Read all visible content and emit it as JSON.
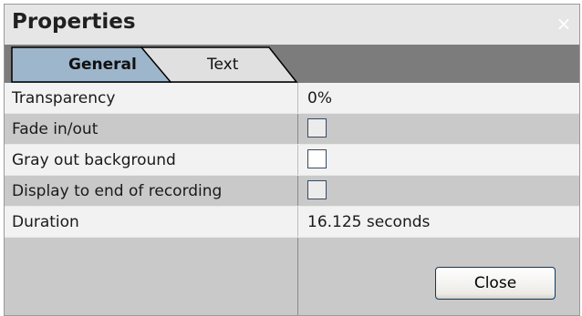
{
  "window": {
    "title": "Properties",
    "close_glyph": "×"
  },
  "tabs": [
    {
      "label": "General",
      "active": true
    },
    {
      "label": "Text",
      "active": false
    }
  ],
  "properties": [
    {
      "label": "Transparency",
      "type": "text",
      "value": "0%"
    },
    {
      "label": "Fade in/out",
      "type": "checkbox",
      "checked": false
    },
    {
      "label": "Gray out background",
      "type": "checkbox",
      "checked": false
    },
    {
      "label": "Display to end of recording",
      "type": "checkbox",
      "checked": false
    },
    {
      "label": "Duration",
      "type": "text",
      "value": "16.125 seconds"
    }
  ],
  "footer": {
    "close_label": "Close"
  },
  "colors": {
    "tabstrip": "#7c7c7c",
    "active_tab": "#9eb6cc",
    "inactive_tab": "#e0e0e0"
  }
}
